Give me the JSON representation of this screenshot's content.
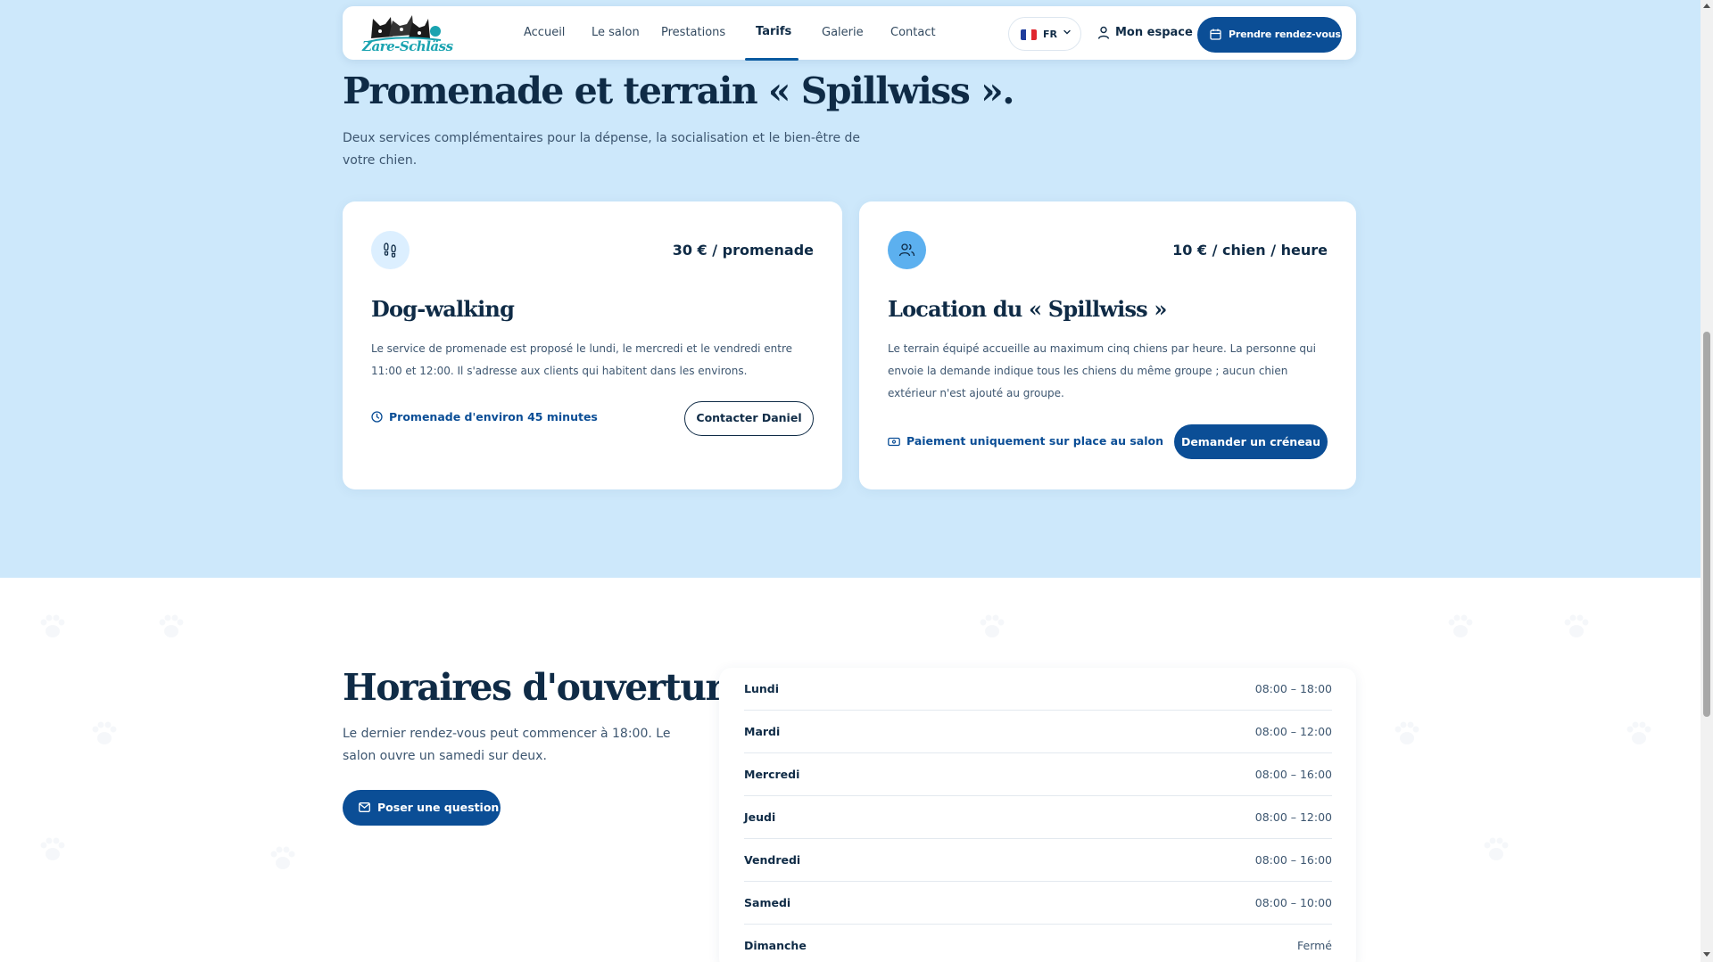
{
  "nav": {
    "logo_text": "Zare-Schläss",
    "links": [
      "Accueil",
      "Le salon",
      "Prestations",
      "Tarifs",
      "Galerie",
      "Contact"
    ],
    "active_link": "Tarifs",
    "language": "FR",
    "account_label": "Mon espace",
    "cta_label": "Prendre rendez-vous"
  },
  "services": {
    "title": "Promenade et terrain « Spillwiss ».",
    "subtitle": "Deux services complémentaires pour la dépense, la socialisation et le bien-être de votre chien.",
    "cards": [
      {
        "icon": "footprints-icon",
        "price": "30 € / promenade",
        "title": "Dog-walking",
        "description": "Le service de promenade est proposé le lundi, le mercredi et le vendredi entre 11:00 et 12:00. Il s'adresse aux clients qui habitent dans les environs.",
        "note": "Promenade d'environ 45 minutes",
        "note_icon": "clock-icon",
        "button": "Contacter Daniel"
      },
      {
        "icon": "users-icon",
        "price": "10 € / chien / heure",
        "title": "Location du « Spillwiss »",
        "description": "Le terrain équipé accueille au maximum cinq chiens par heure. La personne qui envoie la demande indique tous les chiens du même groupe ; aucun chien extérieur n'est ajouté au groupe.",
        "note": "Paiement uniquement sur place au salon",
        "note_icon": "banknote-icon",
        "button": "Demander un créneau"
      }
    ]
  },
  "hours": {
    "title": "Horaires d'ouverture.",
    "subtitle": "Le dernier rendez-vous peut commencer à 18:00. Le salon ouvre un samedi sur deux.",
    "button": "Poser une question",
    "rows": [
      {
        "day": "Lundi",
        "time": "08:00 – 18:00"
      },
      {
        "day": "Mardi",
        "time": "08:00 – 12:00"
      },
      {
        "day": "Mercredi",
        "time": "08:00 – 16:00"
      },
      {
        "day": "Jeudi",
        "time": "08:00 – 12:00"
      },
      {
        "day": "Vendredi",
        "time": "08:00 – 16:00"
      },
      {
        "day": "Samedi",
        "time": "08:00 – 10:00"
      },
      {
        "day": "Dimanche",
        "time": "Fermé"
      }
    ]
  },
  "colors": {
    "hero_bg": "#cde8fb",
    "primary": "#0b4e96",
    "heading": "#0f2b46"
  }
}
